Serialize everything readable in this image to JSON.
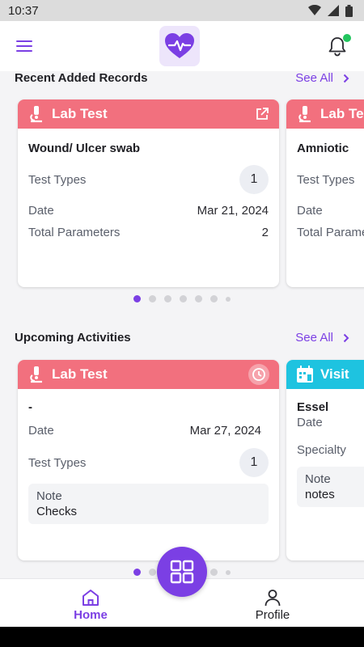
{
  "status_bar": {
    "time": "10:37"
  },
  "app_bar": {
    "menu_icon": "hamburger-menu-icon",
    "logo_icon": "heart-pulse-icon",
    "bell_icon": "bell-icon"
  },
  "recent": {
    "title": "Recent Added Records",
    "see_all": "See All",
    "cards": [
      {
        "type": "Lab Test",
        "title": "Wound/ Ulcer swab",
        "test_types_label": "Test Types",
        "test_types_count": "1",
        "date_label": "Date",
        "date": "Mar 21, 2024",
        "params_label": "Total Parameters",
        "params": "2"
      },
      {
        "type": "Lab Test",
        "title": "Amniotic",
        "test_types_label": "Test Types",
        "date_label": "Date",
        "params_label": "Total Parameters"
      }
    ],
    "dots_active": 0
  },
  "upcoming": {
    "title": "Upcoming Activities",
    "see_all": "See All",
    "cards": [
      {
        "type": "Lab Test",
        "title": "-",
        "date_label": "Date",
        "date": "Mar 27, 2024",
        "test_types_label": "Test Types",
        "test_types_count": "1",
        "note_label": "Note",
        "note": "Checks"
      },
      {
        "type": "Visit",
        "title": "Essel",
        "date_label": "Date",
        "specialty_label": "Specialty",
        "note_label": "Note",
        "note": "notes"
      }
    ]
  },
  "bottom_nav": {
    "home": "Home",
    "profile": "Profile"
  },
  "colors": {
    "accent": "#7b3fe4",
    "lab_header": "#f2707e",
    "visit_header": "#1ec3e0"
  }
}
